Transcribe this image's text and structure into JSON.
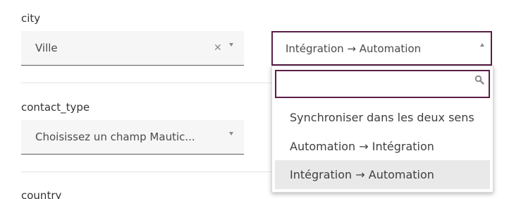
{
  "fields": {
    "city": {
      "label": "city",
      "mautic_value": "Ville",
      "direction_value": "Intégration → Automation"
    },
    "contact_type": {
      "label": "contact_type",
      "mautic_placeholder": "Choisissez un champ Mautic..."
    },
    "country": {
      "label": "country"
    }
  },
  "dropdown": {
    "search_placeholder": "",
    "options": [
      "Synchroniser dans les deux sens",
      "Automation → Intégration",
      "Intégration → Automation"
    ],
    "selected_index": 2
  },
  "icons": {
    "clear": "close-icon",
    "arrow_down": "chevron-down-icon",
    "arrow_up": "chevron-up-icon",
    "search": "search-icon"
  },
  "colors": {
    "accent_border": "#5a1e46",
    "select_bg": "#f6f6f6",
    "selected_option_bg": "#e9e9e9"
  }
}
